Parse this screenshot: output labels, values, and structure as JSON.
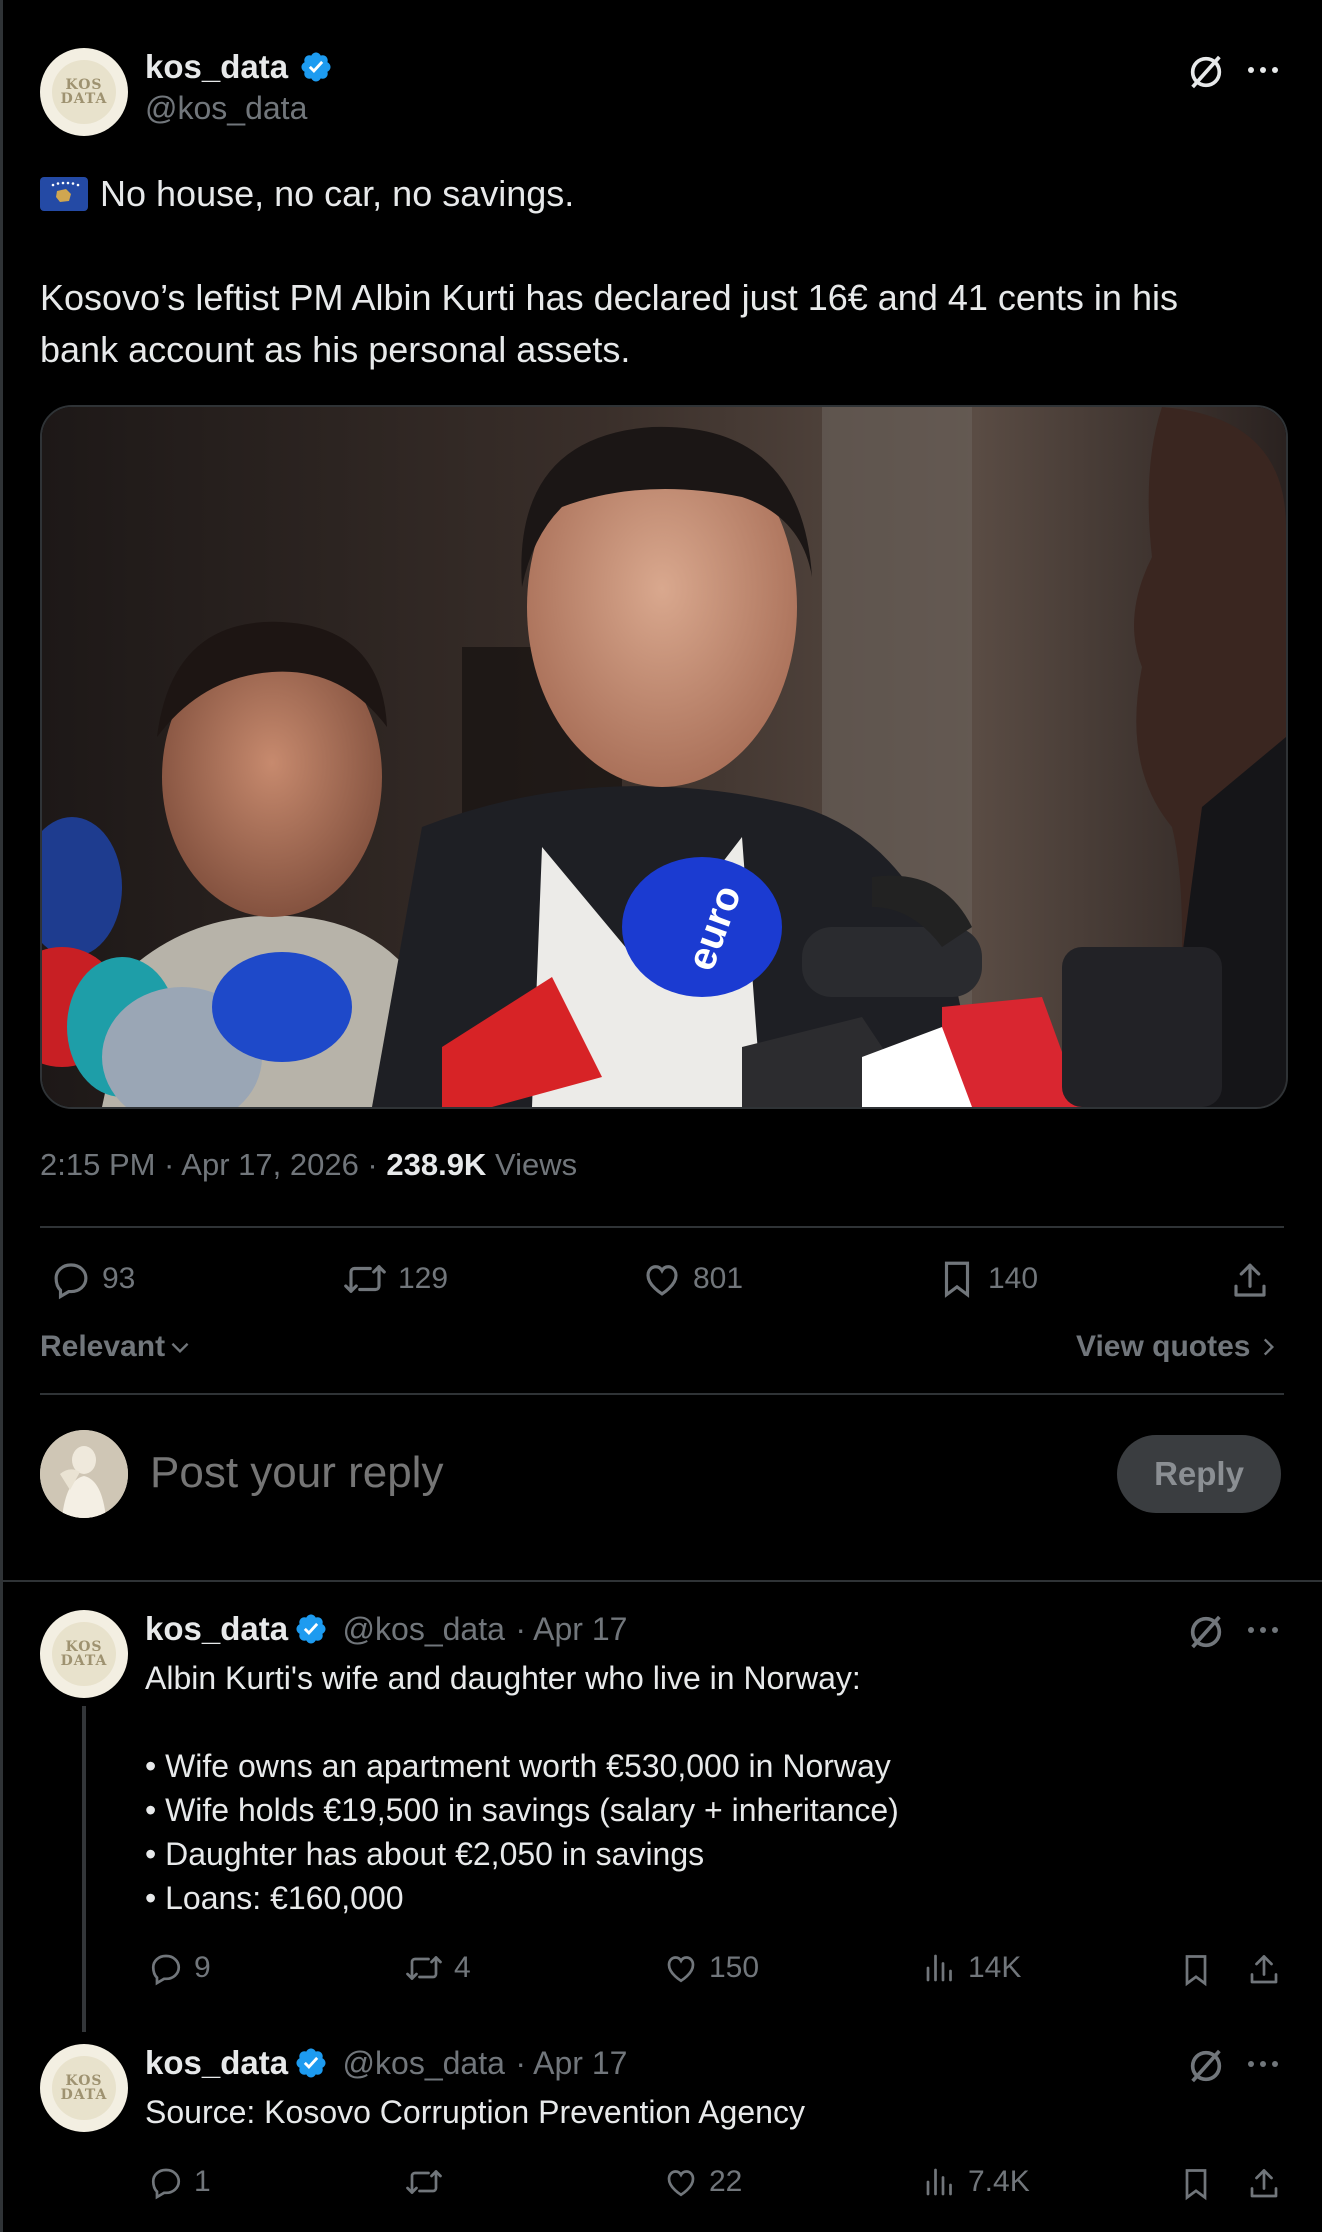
{
  "main_post": {
    "author_name": "kos_data",
    "author_handle": "@kos_data",
    "avatar_text": [
      "KOS",
      "DATA"
    ],
    "flag_label": "Kosovo flag",
    "text_line1": "No house, no car, no savings.",
    "text_line2": "Kosovo’s leftist PM Albin Kurti has declared just 16€ and 41 cents in his",
    "text_line3": "bank account as his personal assets.",
    "image_alt": "Albin Kurti speaking to microphones from press",
    "time": "2:15 PM · Apr 17, 2026 · ",
    "views_count": "238.9K",
    "views_label": "Views",
    "replies": "93",
    "reposts": "129",
    "likes": "801",
    "bookmarks": "140"
  },
  "sort": {
    "label": "Relevant",
    "view_quotes": "View quotes"
  },
  "composer": {
    "placeholder": "Post your reply",
    "button": "Reply"
  },
  "thread": [
    {
      "author_name": "kos_data",
      "author_handle": "@kos_data",
      "date": "· Apr 17",
      "lines": [
        "Albin Kurti's wife and daughter who live in Norway:",
        "• Wife owns an apartment worth €530,000 in Norway",
        "• Wife holds €19,500 in savings (salary + inheritance)",
        "• Daughter has about €2,050 in savings",
        "• Loans: €160,000"
      ],
      "replies": "9",
      "reposts": "4",
      "likes": "150",
      "views": "14K"
    },
    {
      "author_name": "kos_data",
      "author_handle": "@kos_data",
      "date": "· Apr 17",
      "lines": [
        "Source: Kosovo Corruption Prevention Agency"
      ],
      "replies": "1",
      "reposts": "",
      "likes": "22",
      "views": "7.4K"
    }
  ],
  "colors": {
    "background": "#000000",
    "text": "#e7e9ea",
    "secondary": "#71767b",
    "verified": "#1d9bf0",
    "divider": "#2f3336"
  },
  "icons": [
    "verified-badge-icon",
    "grok-icon",
    "more-icon",
    "reply-icon",
    "repost-icon",
    "like-icon",
    "bookmark-icon",
    "share-icon",
    "views-icon",
    "chevron-down-icon",
    "chevron-right-icon"
  ]
}
